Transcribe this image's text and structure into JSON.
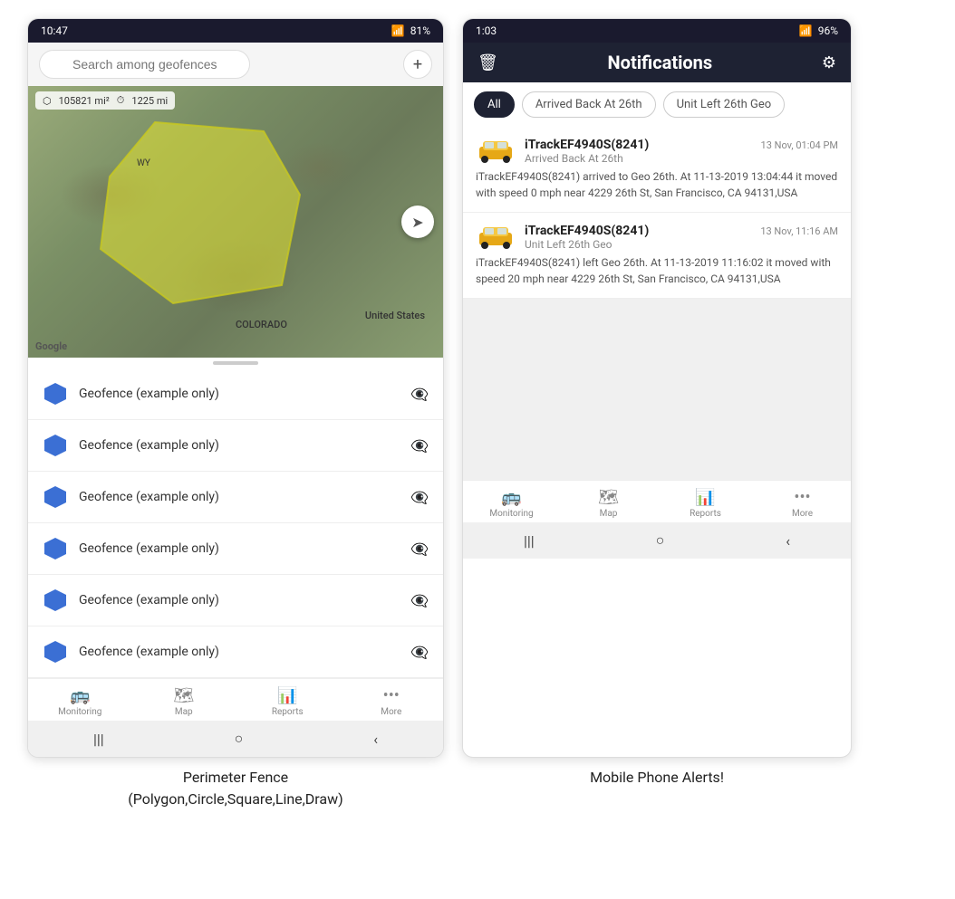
{
  "left_phone": {
    "status_bar": {
      "time": "10:47",
      "wifi": "WiFi",
      "signal": "Signal",
      "battery": "81%"
    },
    "search": {
      "placeholder": "Search among geofences"
    },
    "map": {
      "stat1": "105821 mi²",
      "stat2": "1225 mi",
      "label_us": "United States",
      "label_co": "COLORADO",
      "label_wy": "WY",
      "google": "Google"
    },
    "geofences": [
      {
        "label": "Geofence (example only)"
      },
      {
        "label": "Geofence (example only)"
      },
      {
        "label": "Geofence (example only)"
      },
      {
        "label": "Geofence (example only)"
      },
      {
        "label": "Geofence (example only)"
      },
      {
        "label": "Geofence (example only)"
      }
    ],
    "bottom_nav": [
      {
        "label": "Monitoring",
        "icon": "🚌"
      },
      {
        "label": "Map",
        "icon": "🗺"
      },
      {
        "label": "Reports",
        "icon": "📊"
      },
      {
        "label": "More",
        "icon": "···"
      }
    ]
  },
  "right_phone": {
    "status_bar": {
      "time": "1:03",
      "battery": "96%"
    },
    "header": {
      "title": "Notifications",
      "delete_icon": "🗑",
      "settings_icon": "⚙"
    },
    "filters": [
      {
        "label": "All",
        "active": true
      },
      {
        "label": "Arrived Back At 26th",
        "active": false
      },
      {
        "label": "Unit Left 26th Geo",
        "active": false
      }
    ],
    "notifications": [
      {
        "device": "iTrackEF4940S(8241)",
        "event": "Arrived Back At 26th",
        "time": "13 Nov, 01:04 PM",
        "body": "iTrackEF4940S(8241) arrived to Geo 26th.   At 11-13-2019 13:04:44 it moved with speed 0 mph near 4229 26th St, San Francisco, CA 94131,USA"
      },
      {
        "device": "iTrackEF4940S(8241)",
        "event": "Unit Left 26th Geo",
        "time": "13 Nov, 11:16 AM",
        "body": "iTrackEF4940S(8241) left Geo 26th.   At 11-13-2019 11:16:02 it moved with speed 20 mph near 4229 26th St, San Francisco, CA 94131,USA"
      }
    ],
    "bottom_nav": [
      {
        "label": "Monitoring",
        "icon": "🚌"
      },
      {
        "label": "Map",
        "icon": "🗺"
      },
      {
        "label": "Reports",
        "icon": "📊"
      },
      {
        "label": "More",
        "icon": "···"
      }
    ]
  },
  "captions": {
    "left": "Perimeter Fence\n(Polygon,Circle,Square,Line,Draw)",
    "right": "Mobile Phone Alerts!"
  }
}
